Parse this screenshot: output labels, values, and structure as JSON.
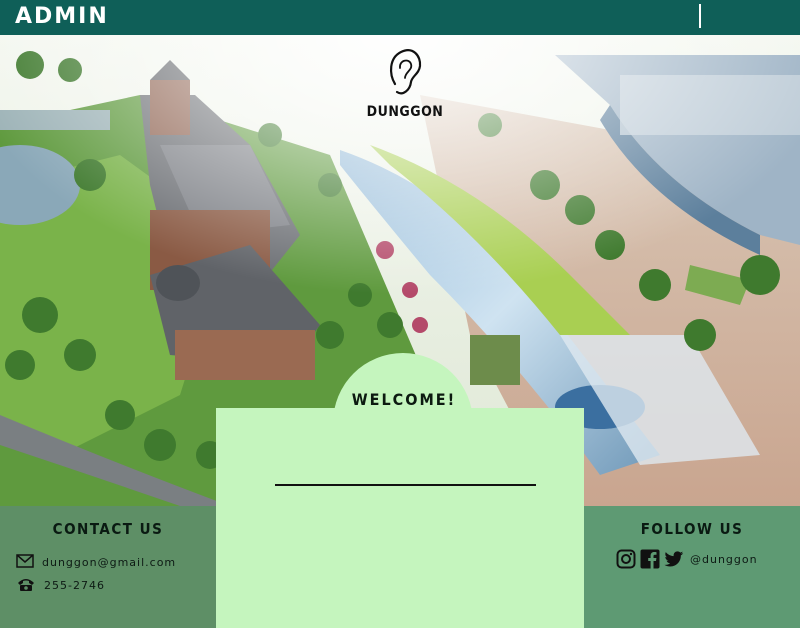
{
  "header": {
    "title": "ADMIN"
  },
  "logo": {
    "icon": "ear-icon",
    "text": "DUNGGON"
  },
  "welcome": {
    "title": "WELCOME!"
  },
  "contact": {
    "title": "CONTACT US",
    "email": "dunggon@gmail.com",
    "phone": "255-2746",
    "email_icon": "mail-icon",
    "phone_icon": "phone-icon"
  },
  "follow": {
    "title": "FOLLOW US",
    "handle": "@dunggon",
    "icons": [
      "instagram-icon",
      "facebook-icon",
      "twitter-icon"
    ]
  },
  "colors": {
    "topbar": "#0f5f58",
    "contact_panel": "#5e8f66",
    "follow_panel": "#5e9a73",
    "welcome_card": "#c5f5be"
  }
}
